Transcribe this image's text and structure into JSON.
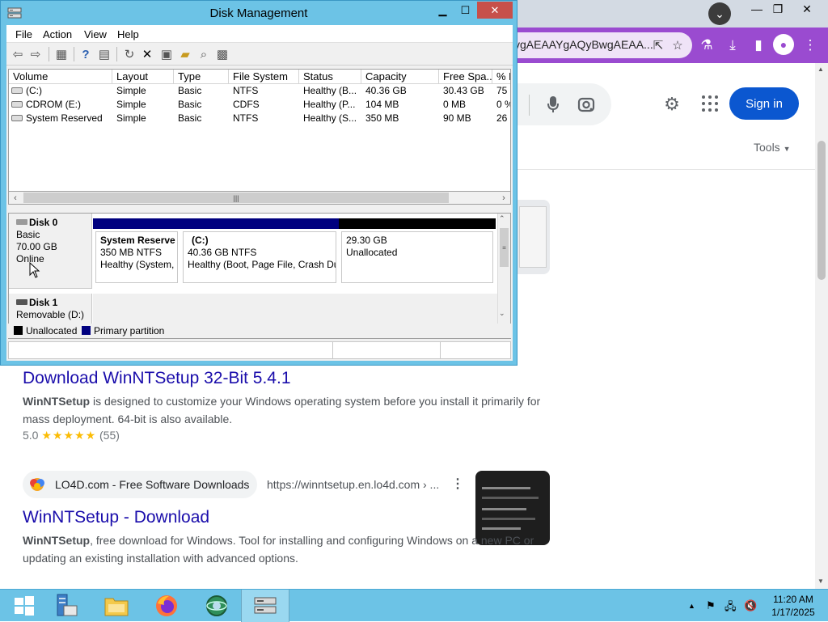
{
  "chrome": {
    "omnibox_text": "vgAEAAYgAQyBwgAEAA...",
    "header": {
      "sign_in_label": "Sign in",
      "tools_label": "Tools"
    },
    "results": [
      {
        "title": "Download WinNTSetup 32-Bit 5.4.1",
        "snippet_bold": "WinNTSetup",
        "snippet_rest": " is designed to customize your Windows operating system before you install it primarily for mass deployment. 64-bit is also available.",
        "rating_value": "5.0",
        "stars": "★★★★★",
        "rating_count": "(55)"
      },
      {
        "source_name": "LO4D.com - Free Software Downloads",
        "source_url": "https://winntsetup.en.lo4d.com › ...",
        "title": "WinNTSetup - Download",
        "snippet_bold": "WinNTSetup",
        "snippet_rest": ", free download for Windows. Tool for installing and configuring Windows on a new PC or updating an existing installation with advanced options."
      }
    ]
  },
  "disk_management": {
    "title": "Disk Management",
    "menu": [
      "File",
      "Action",
      "View",
      "Help"
    ],
    "columns": [
      "Volume",
      "Layout",
      "Type",
      "File System",
      "Status",
      "Capacity",
      "Free Spa...",
      "% F"
    ],
    "volumes": [
      [
        "(C:)",
        "Simple",
        "Basic",
        "NTFS",
        "Healthy (B...",
        "40.36 GB",
        "30.43 GB",
        "75"
      ],
      [
        "CDROM (E:)",
        "Simple",
        "Basic",
        "CDFS",
        "Healthy (P...",
        "104 MB",
        "0 MB",
        "0 %"
      ],
      [
        "System Reserved",
        "Simple",
        "Basic",
        "NTFS",
        "Healthy (S...",
        "350 MB",
        "90 MB",
        "26"
      ]
    ],
    "disks": [
      {
        "name": "Disk 0",
        "type": "Basic",
        "size": "70.00 GB",
        "status": "Online",
        "partitions": [
          {
            "name": "System Reserve",
            "size": "350 MB NTFS",
            "status": "Healthy (System,"
          },
          {
            "name": "(C:)",
            "size": "40.36 GB NTFS",
            "status": "Healthy (Boot, Page File, Crash Du"
          },
          {
            "name": "",
            "size": "29.30 GB",
            "status": "Unallocated"
          }
        ]
      },
      {
        "name": "Disk 1",
        "type": "Removable (D:)"
      }
    ],
    "legend": [
      "Unallocated",
      "Primary partition"
    ],
    "colors": {
      "unallocated": "#000000",
      "primary": "#00007f"
    }
  },
  "taskbar": {
    "time": "11:20 AM",
    "date": "1/17/2025"
  }
}
